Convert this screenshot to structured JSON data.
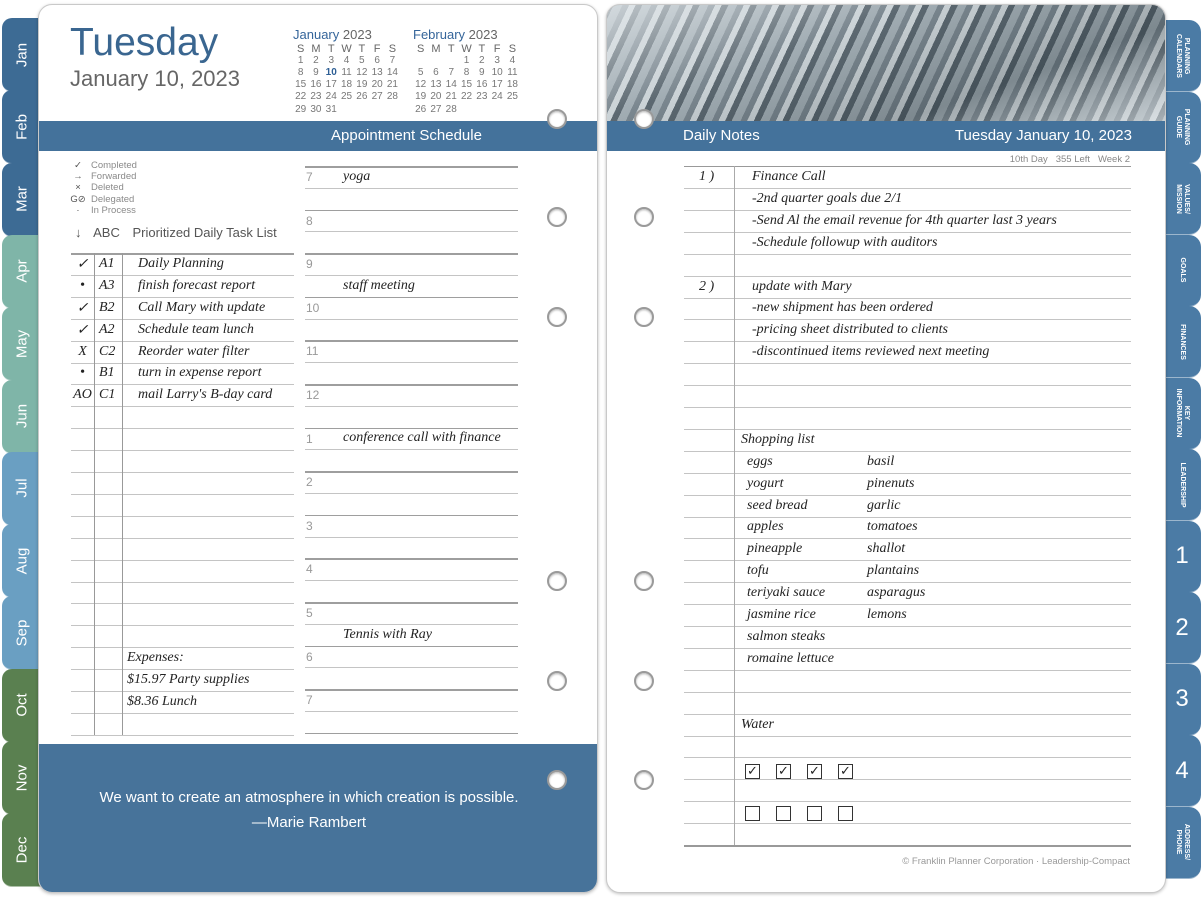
{
  "left_tabs": [
    {
      "label": "Jan",
      "color": "#3d6b94"
    },
    {
      "label": "Feb",
      "color": "#3d6b94"
    },
    {
      "label": "Mar",
      "color": "#3d6b94"
    },
    {
      "label": "Apr",
      "color": "#7fb5a8"
    },
    {
      "label": "May",
      "color": "#7fb5a8"
    },
    {
      "label": "Jun",
      "color": "#7fb5a8"
    },
    {
      "label": "Jul",
      "color": "#6a9fc2"
    },
    {
      "label": "Aug",
      "color": "#6a9fc2"
    },
    {
      "label": "Sep",
      "color": "#6a9fc2"
    },
    {
      "label": "Oct",
      "color": "#5a8050"
    },
    {
      "label": "Nov",
      "color": "#5a8050"
    },
    {
      "label": "Dec",
      "color": "#5a8050"
    }
  ],
  "right_tabs": [
    {
      "label": "PLANNING\nCALENDARS"
    },
    {
      "label": "PLANNING\nGUIDE"
    },
    {
      "label": "VALUES/\nMISSION"
    },
    {
      "label": "GOALS"
    },
    {
      "label": "FINANCES"
    },
    {
      "label": "KEY\nINFORMATION"
    },
    {
      "label": "LEADERSHIP"
    },
    {
      "label": "1",
      "big": true
    },
    {
      "label": "2",
      "big": true
    },
    {
      "label": "3",
      "big": true
    },
    {
      "label": "4",
      "big": true
    },
    {
      "label": "ADDRESS/\nPHONE"
    }
  ],
  "accent_color": "#44729b",
  "header": {
    "day": "Tuesday",
    "date": "January 10, 2023"
  },
  "mini_calendars": [
    {
      "month": "January",
      "year": "2023",
      "weekdays": [
        "S",
        "M",
        "T",
        "W",
        "T",
        "F",
        "S"
      ],
      "highlight": "10",
      "weeks": [
        [
          "1",
          "2",
          "3",
          "4",
          "5",
          "6",
          "7"
        ],
        [
          "8",
          "9",
          "10",
          "11",
          "12",
          "13",
          "14"
        ],
        [
          "15",
          "16",
          "17",
          "18",
          "19",
          "20",
          "21"
        ],
        [
          "22",
          "23",
          "24",
          "25",
          "26",
          "27",
          "28"
        ],
        [
          "29",
          "30",
          "31",
          "",
          "",
          "",
          ""
        ]
      ]
    },
    {
      "month": "February",
      "year": "2023",
      "weekdays": [
        "S",
        "M",
        "T",
        "W",
        "T",
        "F",
        "S"
      ],
      "highlight": "",
      "weeks": [
        [
          "",
          "",
          "",
          "1",
          "2",
          "3",
          "4"
        ],
        [
          "5",
          "6",
          "7",
          "8",
          "9",
          "10",
          "11"
        ],
        [
          "12",
          "13",
          "14",
          "15",
          "16",
          "17",
          "18"
        ],
        [
          "19",
          "20",
          "21",
          "22",
          "23",
          "24",
          "25"
        ],
        [
          "26",
          "27",
          "28",
          "",
          "",
          "",
          ""
        ]
      ]
    }
  ],
  "appointment_title": "Appointment Schedule",
  "legend": [
    {
      "symbol": "✓",
      "label": "Completed"
    },
    {
      "symbol": "→",
      "label": "Forwarded"
    },
    {
      "symbol": "×",
      "label": "Deleted"
    },
    {
      "symbol": "G⊘",
      "label": "Delegated"
    },
    {
      "symbol": "·",
      "label": "In Process"
    }
  ],
  "task_list": {
    "arrow": "↓",
    "abc": "ABC",
    "title": "Prioritized Daily Task List",
    "tasks": [
      {
        "status": "✓",
        "priority": "A1",
        "text": "Daily Planning"
      },
      {
        "status": "•",
        "priority": "A3",
        "text": "finish forecast report"
      },
      {
        "status": "✓",
        "priority": "B2",
        "text": "Call Mary with update"
      },
      {
        "status": "✓",
        "priority": "A2",
        "text": "Schedule team lunch"
      },
      {
        "status": "X",
        "priority": "C2",
        "text": "Reorder water filter"
      },
      {
        "status": "•",
        "priority": "B1",
        "text": "turn in expense report"
      },
      {
        "status": "AO",
        "priority": "C1",
        "text": "mail Larry's B-day card"
      }
    ],
    "expenses": [
      "Expenses:",
      "$15.97 Party supplies",
      "$8.36 Lunch"
    ]
  },
  "schedule": [
    {
      "hour": "7",
      "entry": "yoga",
      "half": 1
    },
    {
      "hour": "8",
      "entry": ""
    },
    {
      "hour": "9",
      "entry": "staff meeting",
      "half": 2
    },
    {
      "hour": "10",
      "entry": ""
    },
    {
      "hour": "11",
      "entry": ""
    },
    {
      "hour": "12",
      "entry": ""
    },
    {
      "hour": "1",
      "entry": "conference call with finance",
      "half": 1
    },
    {
      "hour": "2",
      "entry": ""
    },
    {
      "hour": "3",
      "entry": ""
    },
    {
      "hour": "4",
      "entry": ""
    },
    {
      "hour": "5",
      "entry": "Tennis with Ray",
      "half": 2
    },
    {
      "hour": "6",
      "entry": ""
    },
    {
      "hour": "7",
      "entry": ""
    }
  ],
  "quote": {
    "text": "We want to create an atmosphere in which creation is possible.",
    "author": "—Marie Rambert"
  },
  "notes": {
    "title": "Daily Notes",
    "date": "Tuesday January 10, 2023",
    "stats": "10th Day   355 Left   Week 2",
    "lines": [
      {
        "row": 0,
        "num": "1 )",
        "text": "Finance Call"
      },
      {
        "row": 1,
        "text": "-2nd quarter goals due 2/1"
      },
      {
        "row": 2,
        "text": "-Send Al the email revenue for 4th quarter last 3 years"
      },
      {
        "row": 3,
        "text": "-Schedule followup with auditors"
      },
      {
        "row": 5,
        "num": "2 )",
        "text": "update with Mary"
      },
      {
        "row": 6,
        "text": "-new shipment has been ordered"
      },
      {
        "row": 7,
        "text": "-pricing sheet distributed to clients"
      },
      {
        "row": 8,
        "text": "-discontinued items reviewed next meeting"
      },
      {
        "row": 12,
        "text": "Shopping list"
      },
      {
        "row": 25,
        "text": "Water"
      }
    ],
    "shopping_left": [
      "eggs",
      "yogurt",
      "seed bread",
      "apples",
      "pineapple",
      "tofu",
      "teriyaki sauce",
      "jasmine rice",
      "salmon steaks",
      "romaine lettuce"
    ],
    "shopping_right": [
      "basil",
      "pinenuts",
      "garlic",
      "tomatoes",
      "shallot",
      "plantains",
      "asparagus",
      "lemons"
    ],
    "water_rows": [
      [
        true,
        true,
        true,
        true
      ],
      [
        false,
        false,
        false,
        false
      ]
    ],
    "check_symbol": "✓",
    "footer": "© Franklin Planner Corporation · Leadership-Compact"
  }
}
